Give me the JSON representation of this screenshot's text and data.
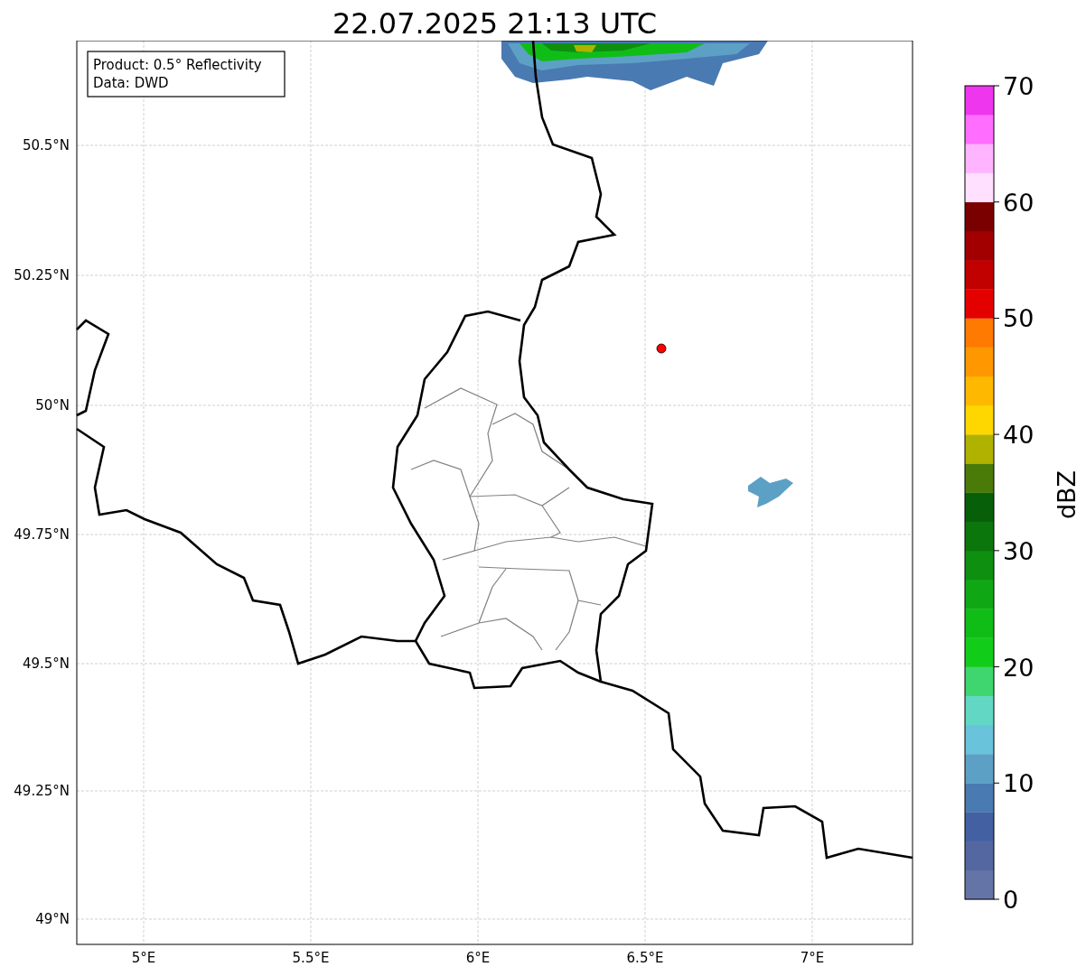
{
  "title": "22.07.2025 21:13 UTC",
  "legend": {
    "lines": [
      "Product: 0.5° Reflectivity",
      "Data: DWD"
    ]
  },
  "map": {
    "xticks": [
      "5°E",
      "5.5°E",
      "6°E",
      "6.5°E",
      "7°E"
    ],
    "yticks": [
      "50.5°N",
      "50.25°N",
      "50°N",
      "49.75°N",
      "49.5°N",
      "49.25°N",
      "49°N"
    ]
  },
  "colorbar": {
    "label": "dBZ",
    "ticks": [
      "70",
      "60",
      "50",
      "40",
      "30",
      "20",
      "10",
      "0"
    ],
    "bins": [
      {
        "color": "#6474a6"
      },
      {
        "color": "#5467a0"
      },
      {
        "color": "#4360a3"
      },
      {
        "color": "#4a7ab2"
      },
      {
        "color": "#5da0c5"
      },
      {
        "color": "#69c3db"
      },
      {
        "color": "#62d8c4"
      },
      {
        "color": "#3fd66f"
      },
      {
        "color": "#12cc1a"
      },
      {
        "color": "#10bd17"
      },
      {
        "color": "#0fa814"
      },
      {
        "color": "#0e8f10"
      },
      {
        "color": "#0b760c"
      },
      {
        "color": "#085f0a"
      },
      {
        "color": "#4a7a08"
      },
      {
        "color": "#b0b200"
      },
      {
        "color": "#ffd700"
      },
      {
        "color": "#ffb800"
      },
      {
        "color": "#ff9800"
      },
      {
        "color": "#ff7a00"
      },
      {
        "color": "#e50000"
      },
      {
        "color": "#c10000"
      },
      {
        "color": "#a20000"
      },
      {
        "color": "#7a0000"
      },
      {
        "color": "#ffe0ff"
      },
      {
        "color": "#ffb4ff"
      },
      {
        "color": "#ff6eff"
      },
      {
        "color": "#ee36ee"
      }
    ]
  }
}
